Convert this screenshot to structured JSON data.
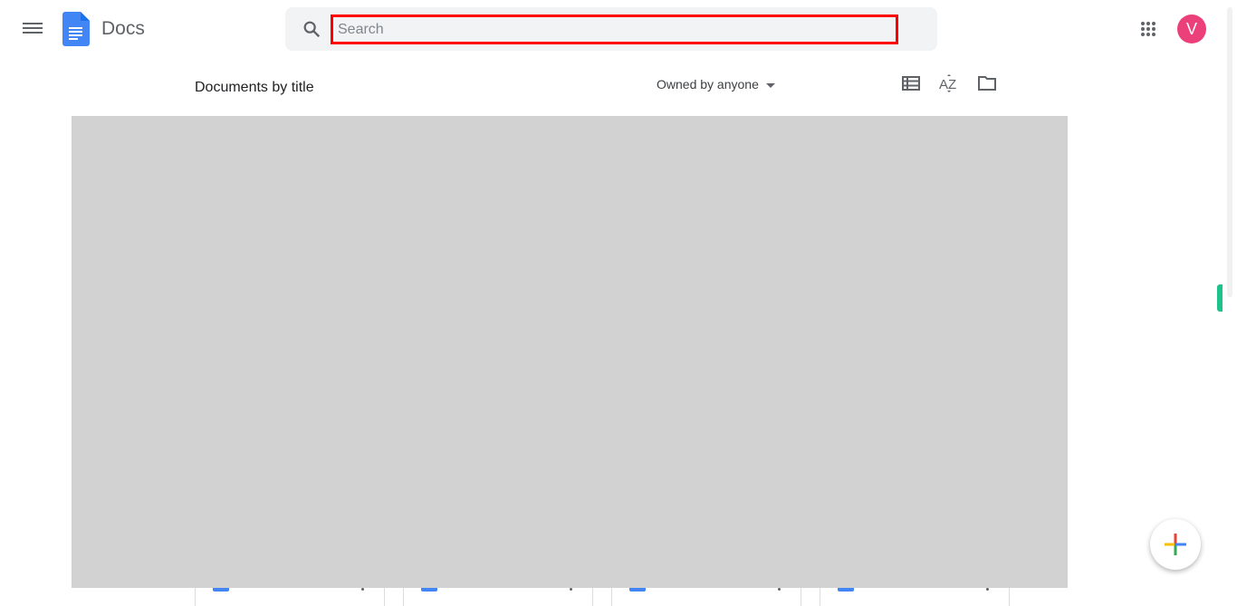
{
  "header": {
    "app_title": "Docs",
    "search_placeholder": "Search",
    "avatar_initial": "V"
  },
  "toolbar": {
    "heading": "Documents by title",
    "owner_filter": "Owned by anyone"
  },
  "icons": {
    "menu": "hamburger-icon",
    "logo": "docs-logo",
    "search": "search-icon",
    "apps": "apps-grid-icon",
    "list_view": "list-view-icon",
    "sort": "sort-az-icon",
    "folder": "folder-icon",
    "new": "plus-icon"
  },
  "colors": {
    "accent": "#4285f4",
    "avatar": "#ec407a",
    "highlight": "#ff0000",
    "overlay": "#d2d2d2"
  }
}
